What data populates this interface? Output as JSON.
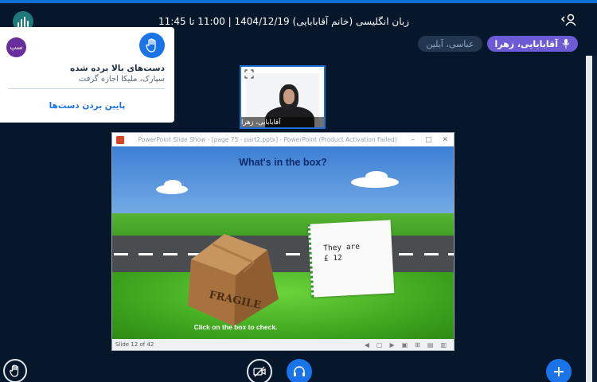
{
  "header": {
    "title": "زبان انگلیسی (خانم آقابابایی) 1404/12/19 | 11:00 تا 11:45"
  },
  "speakers": [
    {
      "name": "آقابابایی، زهرا",
      "state": "talking"
    },
    {
      "name": "عباسی، آیلین",
      "state": "muted"
    }
  ],
  "notification": {
    "avatar_text": "سپ",
    "title": "دست‌های بالا برده شده",
    "subtitle": "سپارک، ملیکا اجازه گرفت",
    "action": "پایین بردن دست‌ها"
  },
  "webcam": {
    "name": "آقابابایی، زهرا"
  },
  "presentation": {
    "window_title": "PowerPoint Slide Show - [page 75 - part2.pptx] - PowerPoint (Product Activation Failed)",
    "slide_question": "What's in the box?",
    "note_text": "They are\n£ 12",
    "box_label": "FRAGILE",
    "instruction": "Click on the box to check.",
    "slide_counter": "Slide 12 of 42"
  },
  "colors": {
    "background": "#06172b",
    "accent": "#1a73e8",
    "talking_pill": "#6d5bd6"
  }
}
